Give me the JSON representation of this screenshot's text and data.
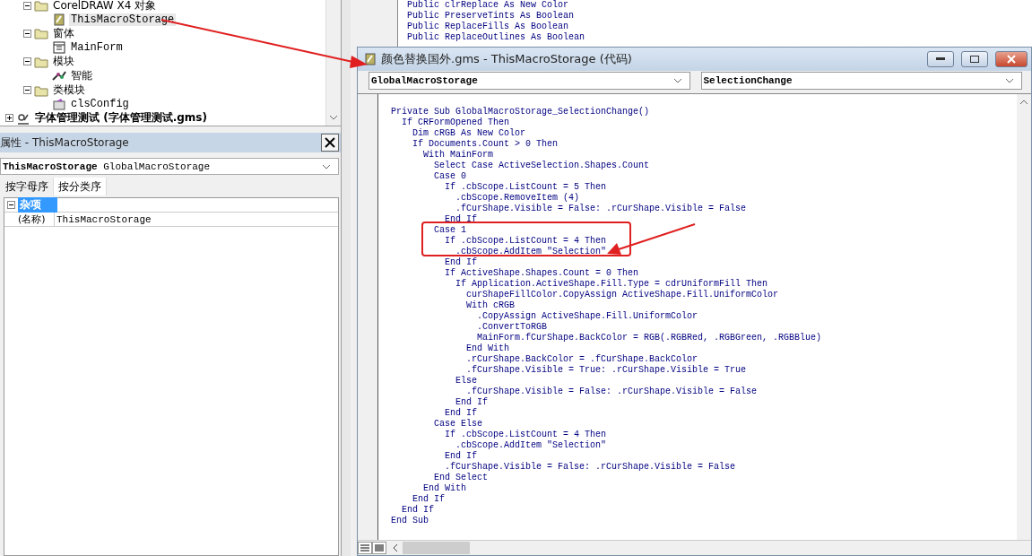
{
  "project_tree": {
    "items": [
      {
        "label": "CorelDRAW X4 对象",
        "kind": "folder",
        "expanded": true,
        "children": [
          {
            "label": "ThisMacroStorage",
            "kind": "document",
            "selected": true
          }
        ]
      },
      {
        "label": "窗体",
        "kind": "folder",
        "expanded": true,
        "children": [
          {
            "label": "MainForm",
            "kind": "form",
            "selected": false
          }
        ]
      },
      {
        "label": "模块",
        "kind": "folder",
        "expanded": true,
        "children": [
          {
            "label": "智能",
            "kind": "module",
            "selected": false
          }
        ]
      },
      {
        "label": "类模块",
        "kind": "folder",
        "expanded": true,
        "children": [
          {
            "label": "clsConfig",
            "kind": "class",
            "selected": false
          }
        ]
      }
    ],
    "next_project": {
      "label": "字体管理测试 (字体管理测试.gms)",
      "kind": "project",
      "expanded": false
    }
  },
  "properties": {
    "title": "属性 - ThisMacroStorage",
    "object_name": "ThisMacroStorage",
    "object_type": "GlobalMacroStorage",
    "tabs": [
      {
        "label": "按字母序",
        "selected": false
      },
      {
        "label": "按分类序",
        "selected": true
      }
    ],
    "category": {
      "label": "杂项",
      "expanded": true,
      "selected": true
    },
    "rows": [
      {
        "name": "(名称)",
        "value": "ThisMacroStorage"
      }
    ]
  },
  "background_code": [
    "Public clrReplace As New Color",
    "Public PreserveTints As Boolean",
    "Public ReplaceFills As Boolean",
    "Public ReplaceOutlines As Boolean"
  ],
  "code_window": {
    "title": "颜色替换国外.gms - ThisMacroStorage (代码)",
    "object_combo": "GlobalMacroStorage",
    "procedure_combo": "SelectionChange",
    "lines": [
      "Private Sub GlobalMacroStorage_SelectionChange()",
      "  If CRFormOpened Then",
      "    Dim cRGB As New Color",
      "    If Documents.Count > 0 Then",
      "      With MainForm",
      "        Select Case ActiveSelection.Shapes.Count",
      "        Case 0",
      "          If .cbScope.ListCount = 5 Then",
      "            .cbScope.RemoveItem (4)",
      "            .fCurShape.Visible = False: .rCurShape.Visible = False",
      "          End If",
      "        Case 1",
      "          If .cbScope.ListCount = 4 Then",
      "            .cbScope.AddItem \"Selection\"",
      "          End If",
      "          If ActiveShape.Shapes.Count = 0 Then",
      "            If Application.ActiveShape.Fill.Type = cdrUniformFill Then",
      "              curShapeFillColor.CopyAssign ActiveShape.Fill.UniformColor",
      "              With cRGB",
      "                .CopyAssign ActiveShape.Fill.UniformColor",
      "                .ConvertToRGB",
      "                MainForm.fCurShape.BackColor = RGB(.RGBRed, .RGBGreen, .RGBBlue)",
      "              End With",
      "              .rCurShape.BackColor = .fCurShape.BackColor",
      "              .fCurShape.Visible = True: .rCurShape.Visible = True",
      "            Else",
      "              .fCurShape.Visible = False: .rCurShape.Visible = False",
      "            End If",
      "          End If",
      "        Case Else",
      "          If .cbScope.ListCount = 4 Then",
      "            .cbScope.AddItem \"Selection\"",
      "          End If",
      "          .fCurShape.Visible = False: .rCurShape.Visible = False",
      "        End Select",
      "      End With",
      "    End If",
      "  End If",
      "End Sub"
    ]
  }
}
